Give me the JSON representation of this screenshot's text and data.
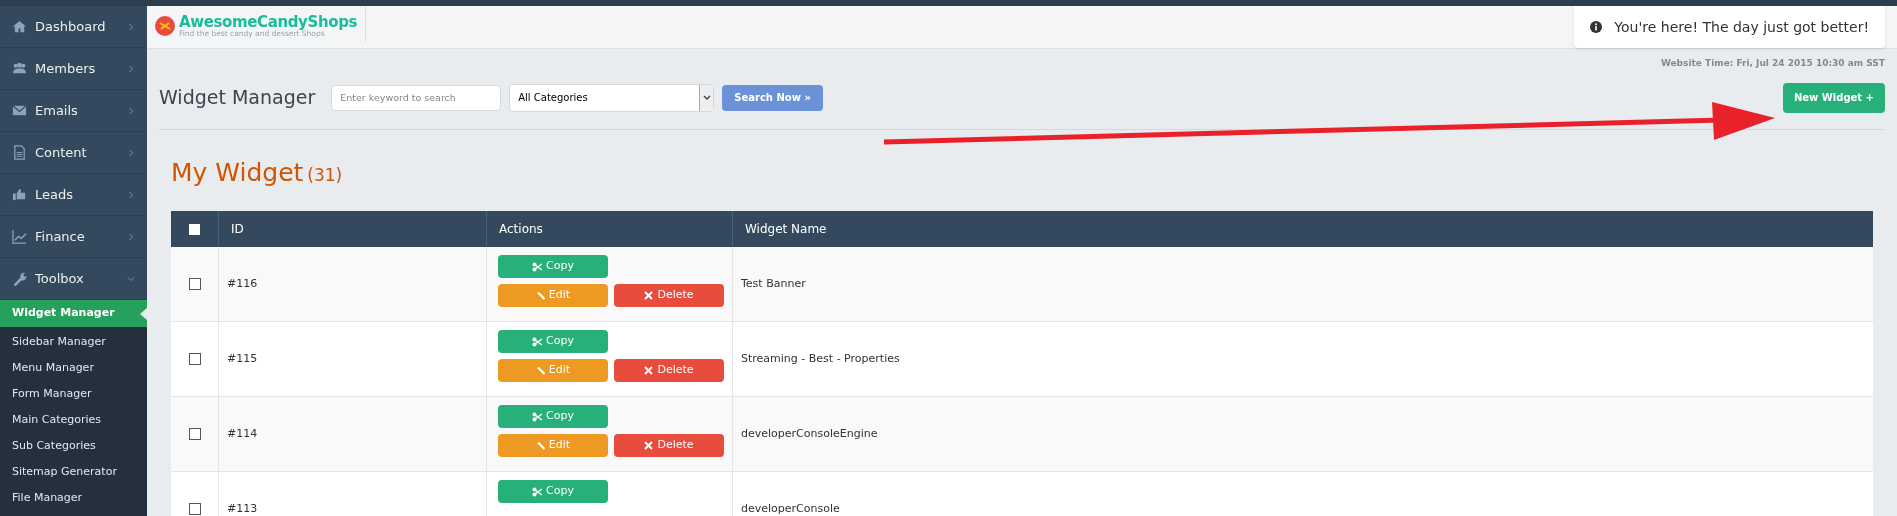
{
  "sidebar": {
    "items": [
      {
        "label": "Dashboard",
        "kind": "home",
        "expanded": false,
        "selected": false
      },
      {
        "label": "Members",
        "kind": "users",
        "expanded": false,
        "selected": false
      },
      {
        "label": "Emails",
        "kind": "mail",
        "expanded": false,
        "selected": false
      },
      {
        "label": "Content",
        "kind": "doc",
        "expanded": false,
        "selected": false
      },
      {
        "label": "Leads",
        "kind": "thumb",
        "expanded": false,
        "selected": false
      },
      {
        "label": "Finance",
        "kind": "chart",
        "expanded": false,
        "selected": false
      },
      {
        "label": "Toolbox",
        "kind": "wrench",
        "expanded": true,
        "selected": false,
        "children": [
          {
            "label": "Widget Manager",
            "selected": true
          },
          {
            "label": "Sidebar Manager",
            "selected": false
          },
          {
            "label": "Menu Manager",
            "selected": false
          },
          {
            "label": "Form Manager",
            "selected": false
          },
          {
            "label": "Main Categories",
            "selected": false
          },
          {
            "label": "Sub Categories",
            "selected": false
          },
          {
            "label": "Sitemap Generator",
            "selected": false
          },
          {
            "label": "File Manager",
            "selected": false
          }
        ]
      }
    ]
  },
  "logo": {
    "name": "AwesomeCandyShops",
    "tagline": "Find the best candy and dessert Shops"
  },
  "notification": "You're here! The day just got better!",
  "website_time": "Website Time: Fri, Jul 24 2015 10:30 am SST",
  "toolbar": {
    "title": "Widget Manager",
    "search": {
      "placeholder": "Enter keyword to search"
    },
    "category": "All Categories",
    "search_button": "Search Now »",
    "new_button": "New Widget +"
  },
  "heading": {
    "title": "My Widget",
    "count": "(31)"
  },
  "table": {
    "columns": [
      "ID",
      "Actions",
      "Widget Name"
    ],
    "select_all": {
      "checked": false
    },
    "rows": [
      {
        "checked": false,
        "id": "#116",
        "name": "Test Banner",
        "actions": [
          {
            "kind": "copy",
            "label": "Copy"
          },
          {
            "kind": "edit",
            "label": "Edit"
          },
          {
            "kind": "delete",
            "label": "Delete"
          }
        ]
      },
      {
        "checked": false,
        "id": "#115",
        "name": "Streaming - Best - Properties",
        "actions": [
          {
            "kind": "copy",
            "label": "Copy"
          },
          {
            "kind": "edit",
            "label": "Edit"
          },
          {
            "kind": "delete",
            "label": "Delete"
          }
        ]
      },
      {
        "checked": false,
        "id": "#114",
        "name": "developerConsoleEngine",
        "actions": [
          {
            "kind": "copy",
            "label": "Copy"
          },
          {
            "kind": "edit",
            "label": "Edit"
          },
          {
            "kind": "delete",
            "label": "Delete"
          }
        ]
      },
      {
        "checked": false,
        "id": "#113",
        "name": "developerConsole",
        "actions": [
          {
            "kind": "copy",
            "label": "Copy"
          }
        ]
      }
    ]
  }
}
